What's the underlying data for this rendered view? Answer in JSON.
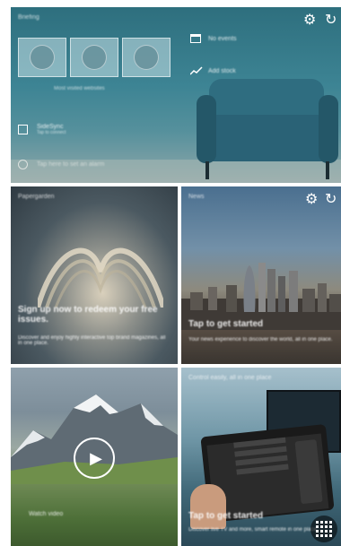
{
  "top_tile": {
    "label": "Briefing",
    "thumbs_caption": "Most visited websites",
    "events_text": "No events",
    "stock_text": "Add stock",
    "sidesync_title": "SideSync",
    "sidesync_sub": "Tap to connect",
    "alarm_text": "Tap here to set an alarm"
  },
  "magazine_tile": {
    "label": "Papergarden",
    "headline": "Sign up now to redeem your free issues.",
    "body": "Discover and enjoy highly interactive top brand magazines, all in one place."
  },
  "news_tile": {
    "label": "News",
    "headline": "Tap to get started",
    "body": "Your news experience to discover the world, all in one place."
  },
  "video_tile": {
    "caption": "Watch video"
  },
  "tv_tile": {
    "label": "Control easily, all in one place",
    "headline": "Tap to get started",
    "body": "Discover live TV and more, smart remote in one place."
  },
  "icons": {
    "settings": "gear-icon",
    "refresh": "refresh-icon",
    "calendar": "calendar-icon",
    "stock": "stock-chart-icon",
    "sidesync": "sidesync-icon",
    "alarm": "alarm-icon",
    "play": "play-icon",
    "apps": "apps-grid-icon"
  },
  "colors": {
    "top_tile_accent": "#3d8494",
    "chair": "#2f6d80"
  }
}
